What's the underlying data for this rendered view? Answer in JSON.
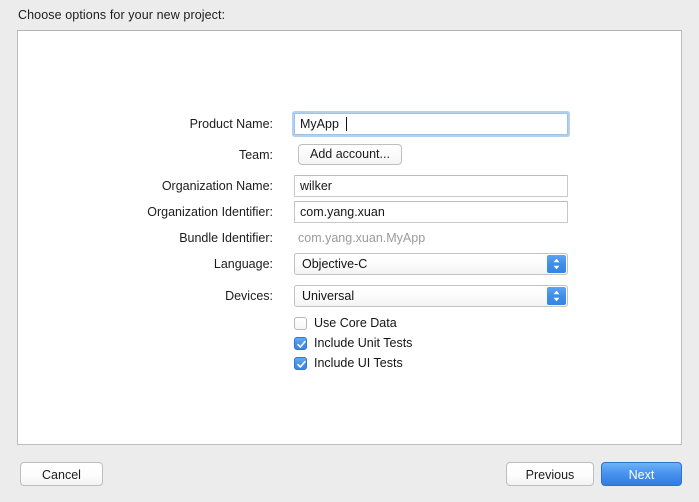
{
  "dialog": {
    "title": "Choose options for your new project:",
    "accent_color": "#3f8ee8",
    "primary_button_color": "#4a94ef"
  },
  "form": {
    "rows": [
      {
        "label": "Product Name:",
        "value": "MyApp",
        "type": "textfield",
        "focused": true
      },
      {
        "label": "Team:",
        "value": "Add account...",
        "type": "button"
      },
      {
        "label": "Organization Name:",
        "value": "wilker",
        "type": "textfield",
        "focused": false
      },
      {
        "label": "Organization Identifier:",
        "value": "com.yang.xuan",
        "type": "textfield",
        "focused": false
      },
      {
        "label": "Bundle Identifier:",
        "value": "com.yang.xuan.MyApp",
        "type": "static"
      },
      {
        "label": "Language:",
        "value": "Objective-C",
        "type": "popup"
      },
      {
        "label": "Devices:",
        "value": "Universal",
        "type": "popup"
      }
    ]
  },
  "checkboxes": [
    {
      "label": "Use Core Data",
      "checked": false
    },
    {
      "label": "Include Unit Tests",
      "checked": true
    },
    {
      "label": "Include UI Tests",
      "checked": true
    }
  ],
  "buttons": {
    "cancel": "Cancel",
    "previous": "Previous",
    "next": "Next"
  }
}
